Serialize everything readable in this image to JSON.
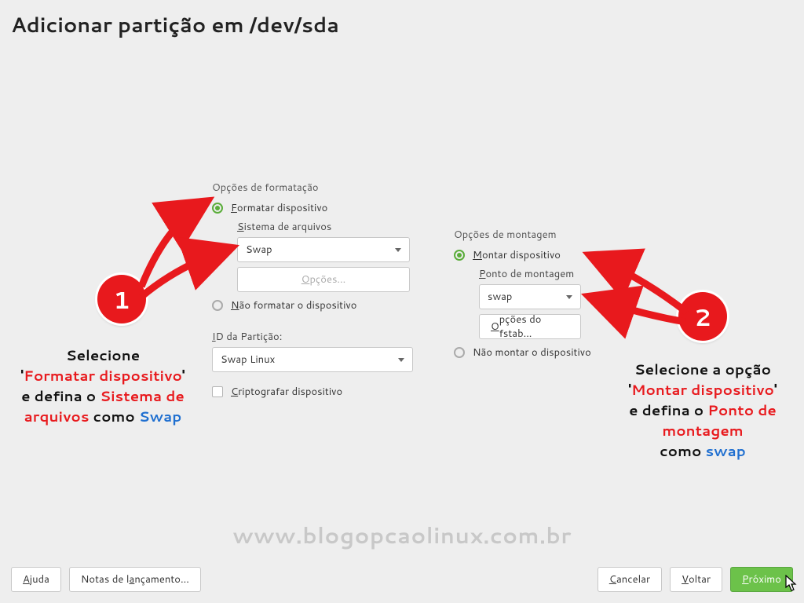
{
  "title": "Adicionar partição em /dev/sda",
  "left": {
    "section": "Opções de formatação",
    "format_label": "ormatar dispositivo",
    "format_ul": "F",
    "fs_label": "istema de arquivos",
    "fs_ul": "S",
    "fs_value": "Swap",
    "options_btn": "pções...",
    "options_ul": "O",
    "noformat_label": "ão formatar o dispositivo",
    "noformat_ul": "N",
    "pid_label": "D da Partição:",
    "pid_ul": "I",
    "pid_value": "Swap Linux",
    "crypt_label": "riptografar dispositivo",
    "crypt_ul": "C"
  },
  "right": {
    "section": "Opções de montagem",
    "mount_label": "ontar dispositivo",
    "mount_ul": "M",
    "mp_label": "onto de montagem",
    "mp_ul": "P",
    "mp_value": "swap",
    "fstab_btn": "pções do fstab...",
    "fstab_ul": "O",
    "nomount_label": "Não montar o dispositivo"
  },
  "footer": {
    "help": "A",
    "help2": "juda",
    "notes": "Notas de l",
    "notes_ul": "a",
    "notes2": "nçamento...",
    "cancel": "C",
    "cancel2": "ancelar",
    "back": "V",
    "back2": "oltar",
    "next": "P",
    "next2": "róximo"
  },
  "watermark": "www.blogopcaolinux.com.br",
  "anno1": {
    "l1a": "Selecione",
    "l2a": "'",
    "l2b": "Formatar dispositivo",
    "l2c": "'",
    "l3a": "e defina o ",
    "l3b": "Sistema de",
    "l4a": "arquivos",
    "l4b": " como ",
    "l4c": "Swap"
  },
  "anno2": {
    "l1": "Selecione a opção",
    "l2a": "'",
    "l2b": "Montar dispositivo",
    "l2c": "'",
    "l3a": "e defina o ",
    "l3b": "Ponto de montagem",
    "l4a": "como ",
    "l4b": "swap"
  },
  "bubble1": "1",
  "bubble2": "2"
}
